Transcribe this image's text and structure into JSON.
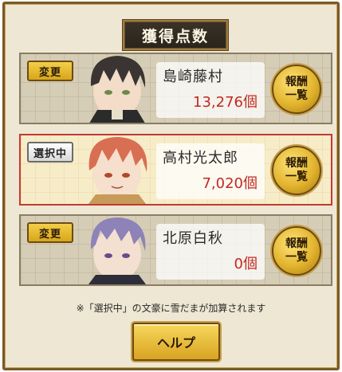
{
  "title": "獲得点数",
  "cards": [
    {
      "badge": "変更",
      "name": "島崎藤村",
      "count": "13,276個",
      "reward_line1": "報酬",
      "reward_line2": "一覧",
      "selected": false,
      "hair_color": "#3a3532"
    },
    {
      "badge": "選択中",
      "name": "高村光太郎",
      "count": "7,020個",
      "reward_line1": "報酬",
      "reward_line2": "一覧",
      "selected": true,
      "hair_color": "#d86e52"
    },
    {
      "badge": "変更",
      "name": "北原白秋",
      "count": "0個",
      "reward_line1": "報酬",
      "reward_line2": "一覧",
      "selected": false,
      "hair_color": "#8d83b8"
    }
  ],
  "note": "※「選択中」の文豪に雪だまが加算されます",
  "help_label": "ヘルプ",
  "colors": {
    "accent_gold": "#e2b42d",
    "selected_border": "#c23a33",
    "count_red": "#c02a22",
    "frame": "#7a5a26"
  }
}
